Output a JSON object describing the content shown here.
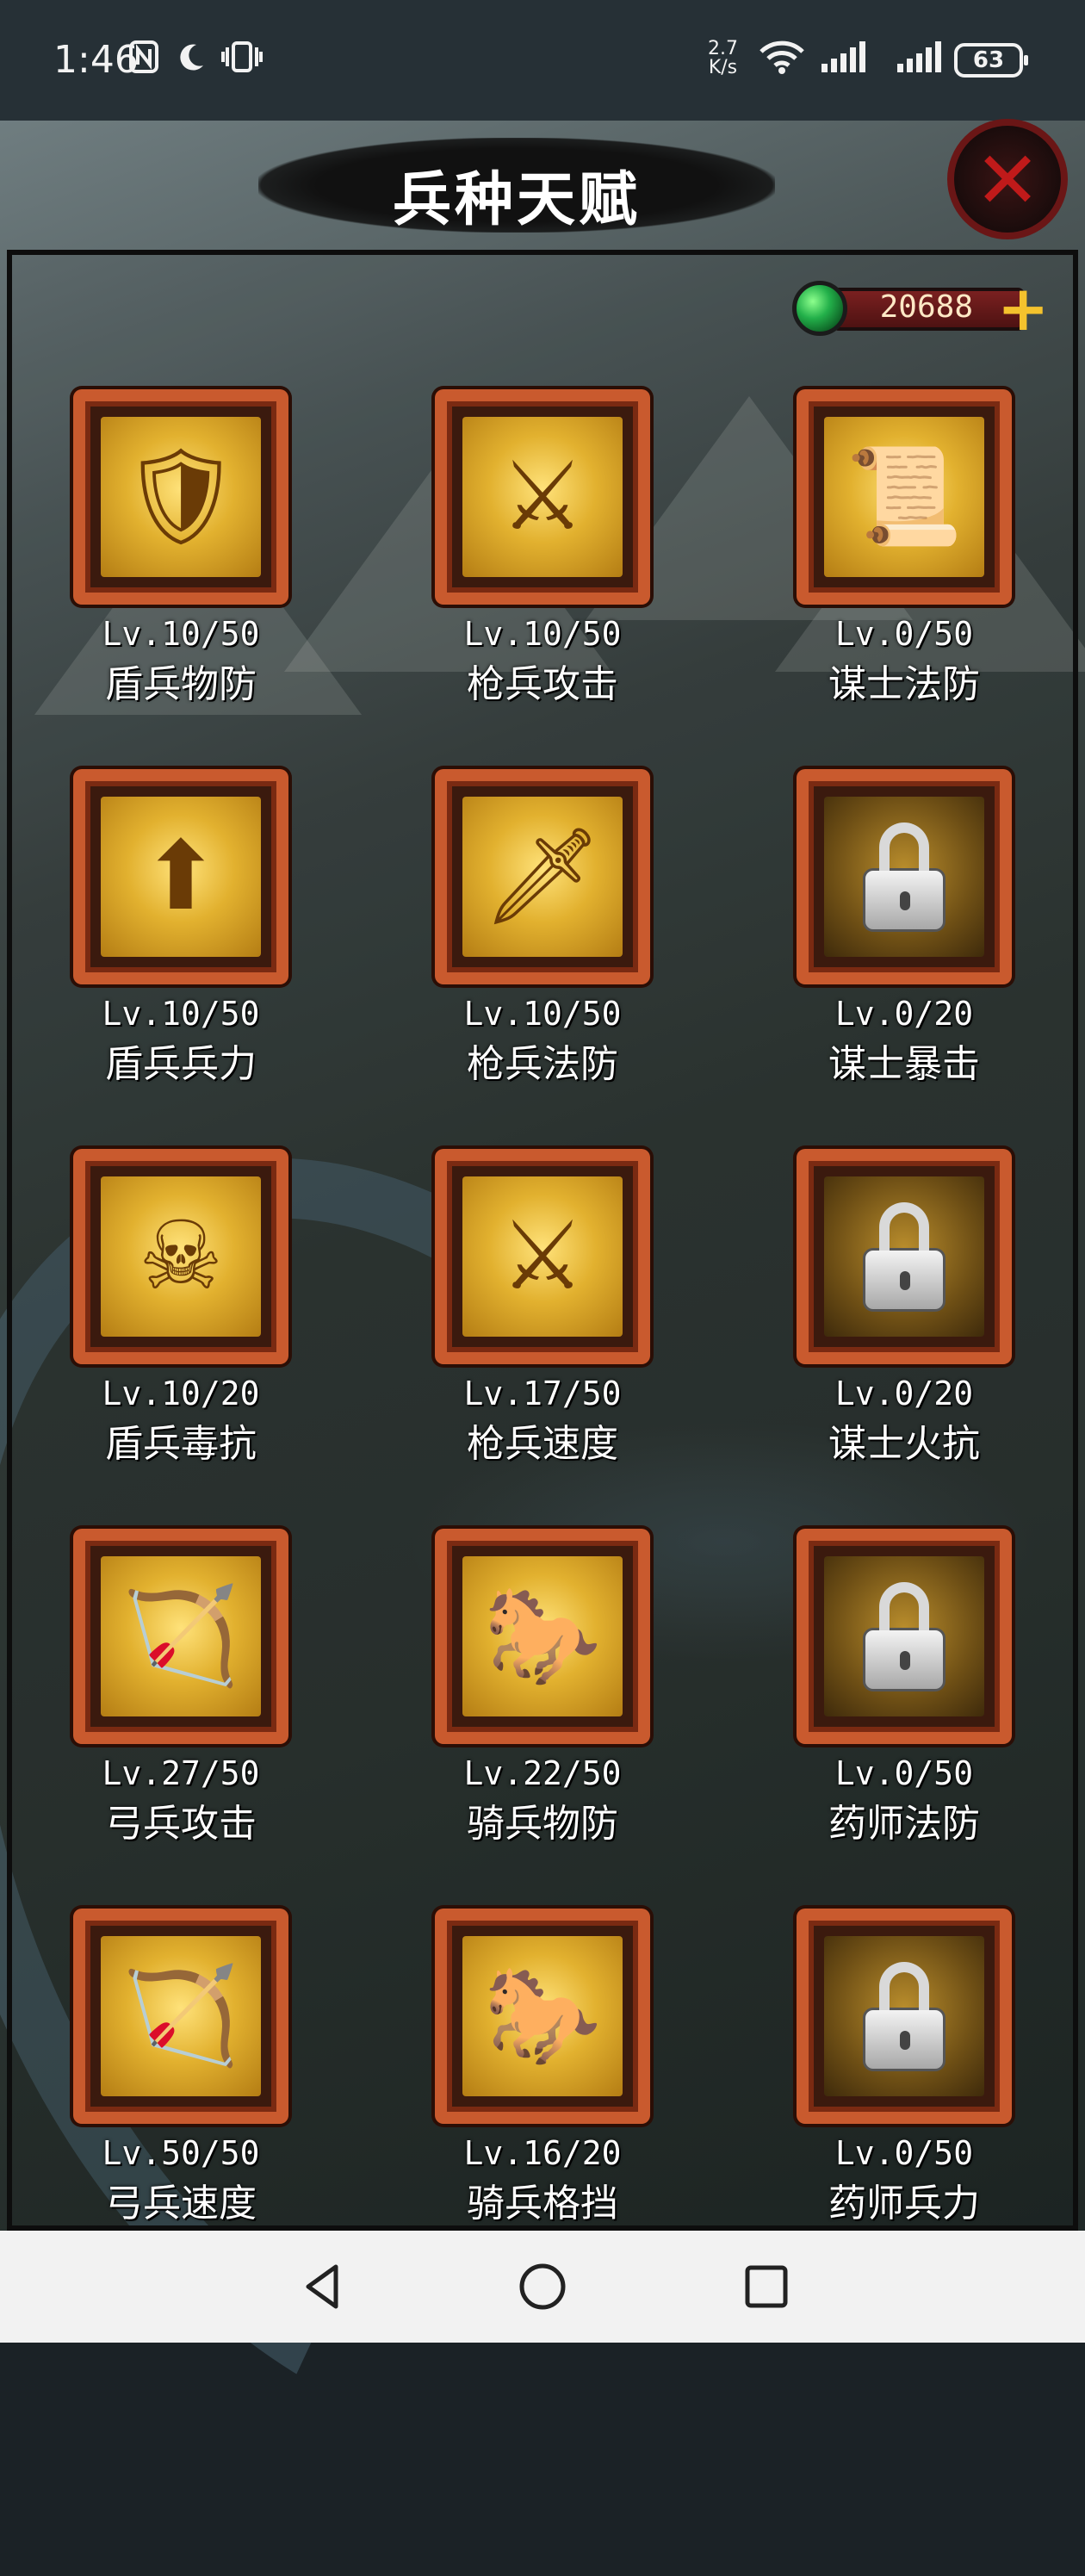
{
  "status_bar": {
    "time": "1:46",
    "net_speed_value": "2.7",
    "net_speed_unit": "K/s",
    "battery": "63",
    "icons": [
      "nfc-icon",
      "moon-icon",
      "vibrate-icon",
      "wifi-icon",
      "signal-icon",
      "signal-icon"
    ]
  },
  "header": {
    "title": "兵种天赋",
    "close_icon": "close-icon"
  },
  "currency": {
    "icon": "emerald-gem-icon",
    "value": "20688",
    "add_label": "+"
  },
  "talents": [
    {
      "level": "Lv.10/50",
      "name": "盾兵物防",
      "icon": "shield-soldier-icon",
      "locked": false
    },
    {
      "level": "Lv.10/50",
      "name": "枪兵攻击",
      "icon": "spearman-icon",
      "locked": false
    },
    {
      "level": "Lv.0/50",
      "name": "谋士法防",
      "icon": "strategist-icon",
      "locked": false
    },
    {
      "level": "Lv.10/50",
      "name": "盾兵兵力",
      "icon": "shield-arrow-icon",
      "locked": false
    },
    {
      "level": "Lv.10/50",
      "name": "枪兵法防",
      "icon": "spear-shield-icon",
      "locked": false
    },
    {
      "level": "Lv.0/20",
      "name": "谋士暴击",
      "icon": "lock-icon",
      "locked": true
    },
    {
      "level": "Lv.10/20",
      "name": "盾兵毒抗",
      "icon": "skull-shield-icon",
      "locked": false
    },
    {
      "level": "Lv.17/50",
      "name": "枪兵速度",
      "icon": "charging-spearman-icon",
      "locked": false
    },
    {
      "level": "Lv.0/20",
      "name": "谋士火抗",
      "icon": "lock-icon",
      "locked": true
    },
    {
      "level": "Lv.27/50",
      "name": "弓兵攻击",
      "icon": "archer-icon",
      "locked": false
    },
    {
      "level": "Lv.22/50",
      "name": "骑兵物防",
      "icon": "cavalry-icon",
      "locked": false
    },
    {
      "level": "Lv.0/50",
      "name": "药师法防",
      "icon": "lock-icon",
      "locked": true
    },
    {
      "level": "Lv.50/50",
      "name": "弓兵速度",
      "icon": "running-archer-icon",
      "locked": false
    },
    {
      "level": "Lv.16/20",
      "name": "骑兵格挡",
      "icon": "cavalry-shield-icon",
      "locked": false
    },
    {
      "level": "Lv.0/50",
      "name": "药师兵力",
      "icon": "lock-icon",
      "locked": true
    }
  ],
  "nav": {
    "back_icon": "back-triangle-icon",
    "home_icon": "home-circle-icon",
    "recents_icon": "recents-square-icon"
  }
}
